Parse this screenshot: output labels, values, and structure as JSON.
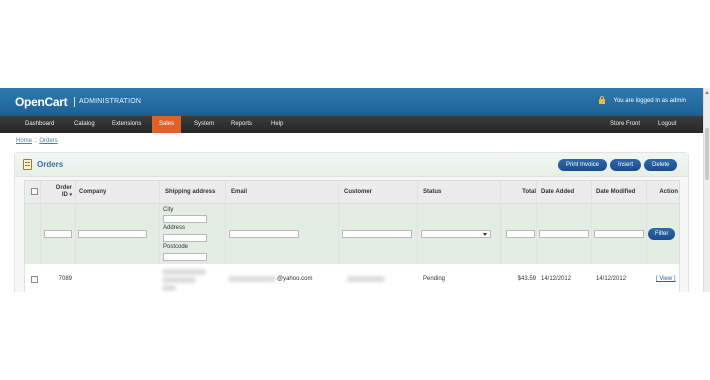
{
  "header": {
    "logo": "OpenCart",
    "subtitle": "ADMINISTRATION",
    "login_status": "You are logged in as admin"
  },
  "menu": {
    "items": [
      "Dashboard",
      "Catalog",
      "Extensions",
      "Sales",
      "System",
      "Reports",
      "Help"
    ],
    "active": "Sales",
    "right_items": [
      "Store Front",
      "Logout"
    ]
  },
  "breadcrumb": [
    "Home",
    "Orders"
  ],
  "panel": {
    "title": "Orders",
    "buttons": [
      "Print Invoice",
      "Insert",
      "Delete"
    ]
  },
  "table": {
    "columns": [
      "Order ID",
      "Company",
      "Shipping address",
      "Email",
      "Customer",
      "Status",
      "Total",
      "Date Added",
      "Date Modified",
      "Action"
    ],
    "order_id_lines": [
      "Order",
      "ID"
    ],
    "sort_indicator": "▾",
    "filter": {
      "shipping_labels": [
        "City",
        "Address",
        "Postcode"
      ],
      "button": "Filter"
    },
    "rows": [
      {
        "order_id": "7089",
        "email_suffix": "@yahoo.com",
        "status": "Pending",
        "total": "$43.59",
        "date_added": "14/12/2012",
        "date_modified": "14/12/2012",
        "action": "[ View ]"
      }
    ]
  },
  "colors": {
    "header_blue": "#2f7cb2",
    "menu_dark": "#2e2e2e",
    "menu_active": "#e0622b",
    "button_blue": "#1b4d8e",
    "filter_row": "#e4ede4"
  }
}
